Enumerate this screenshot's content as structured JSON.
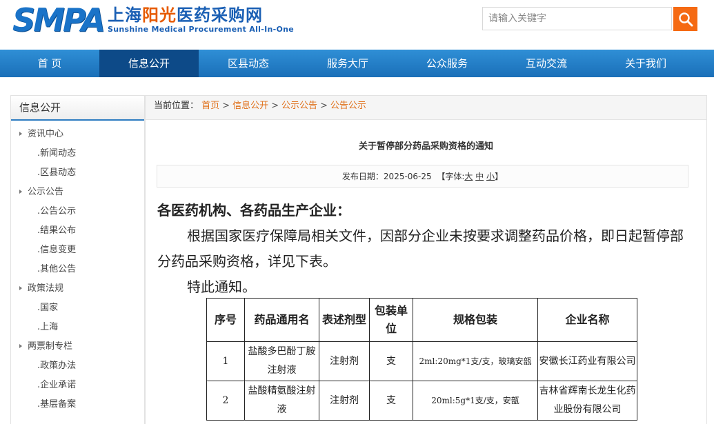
{
  "header": {
    "logo_main": "SMPA",
    "logo_cn_blue": "上海",
    "logo_cn_orange": "阳光",
    "logo_cn_rest": "医药采购网",
    "logo_en": "Sunshine Medical Procurement All-In-One",
    "search_placeholder": "请输入关键字"
  },
  "nav": [
    "首 页",
    "信息公开",
    "区县动态",
    "服务大厅",
    "公众服务",
    "互动交流",
    "关于我们"
  ],
  "sidebar": {
    "title": "信息公开",
    "items": [
      {
        "type": "cat",
        "label": "资讯中心"
      },
      {
        "type": "sub",
        "label": ".新闻动态"
      },
      {
        "type": "sub",
        "label": ".区县动态"
      },
      {
        "type": "cat",
        "label": "公示公告"
      },
      {
        "type": "sub",
        "label": ".公告公示"
      },
      {
        "type": "sub",
        "label": ".结果公布"
      },
      {
        "type": "sub",
        "label": ".信息变更"
      },
      {
        "type": "sub",
        "label": ".其他公告"
      },
      {
        "type": "cat",
        "label": "政策法规"
      },
      {
        "type": "sub",
        "label": ".国家"
      },
      {
        "type": "sub",
        "label": ".上海"
      },
      {
        "type": "cat",
        "label": "两票制专栏"
      },
      {
        "type": "sub",
        "label": ".政策办法"
      },
      {
        "type": "sub",
        "label": ".企业承诺"
      },
      {
        "type": "sub",
        "label": ".基层备案"
      }
    ]
  },
  "breadcrumb": {
    "prefix": "当前位置：",
    "items": [
      "首页",
      "信息公开",
      "公示公告",
      "公告公示"
    ]
  },
  "article": {
    "title": "关于暂停部分药品采购资格的通知",
    "date_label": "发布日期：",
    "date": "2025-06-25",
    "font_label": "【字体:",
    "font_large": "大",
    "font_medium": "中",
    "font_small": "小",
    "font_close": "】",
    "greeting": "各医药机构、各药品生产企业：",
    "paragraph": "根据国家医疗保障局相关文件，因部分企业未按要求调整药品价格，即日起暂停部分药品采购资格，详见下表。",
    "closing": "特此通知。"
  },
  "table": {
    "headers": [
      "序号",
      "药品通用名",
      "表述剂型",
      "包装单位",
      "规格包装",
      "企业名称"
    ],
    "rows": [
      [
        "1",
        "盐酸多巴酚丁胺注射液",
        "注射剂",
        "支",
        "2ml:20mg*1支/支，玻璃安瓿",
        "安徽长江药业有限公司"
      ],
      [
        "2",
        "盐酸精氨酸注射液",
        "注射剂",
        "支",
        "20ml:5g*1支/支，安瓿",
        "吉林省辉南长龙生化药业股份有限公司"
      ]
    ]
  },
  "colors": {
    "brand_blue": "#1a73c8",
    "nav_blue": "#1a6fb8",
    "nav_active": "#0d4a88",
    "accent_orange": "#f56a13",
    "link_orange": "#e0701a"
  }
}
